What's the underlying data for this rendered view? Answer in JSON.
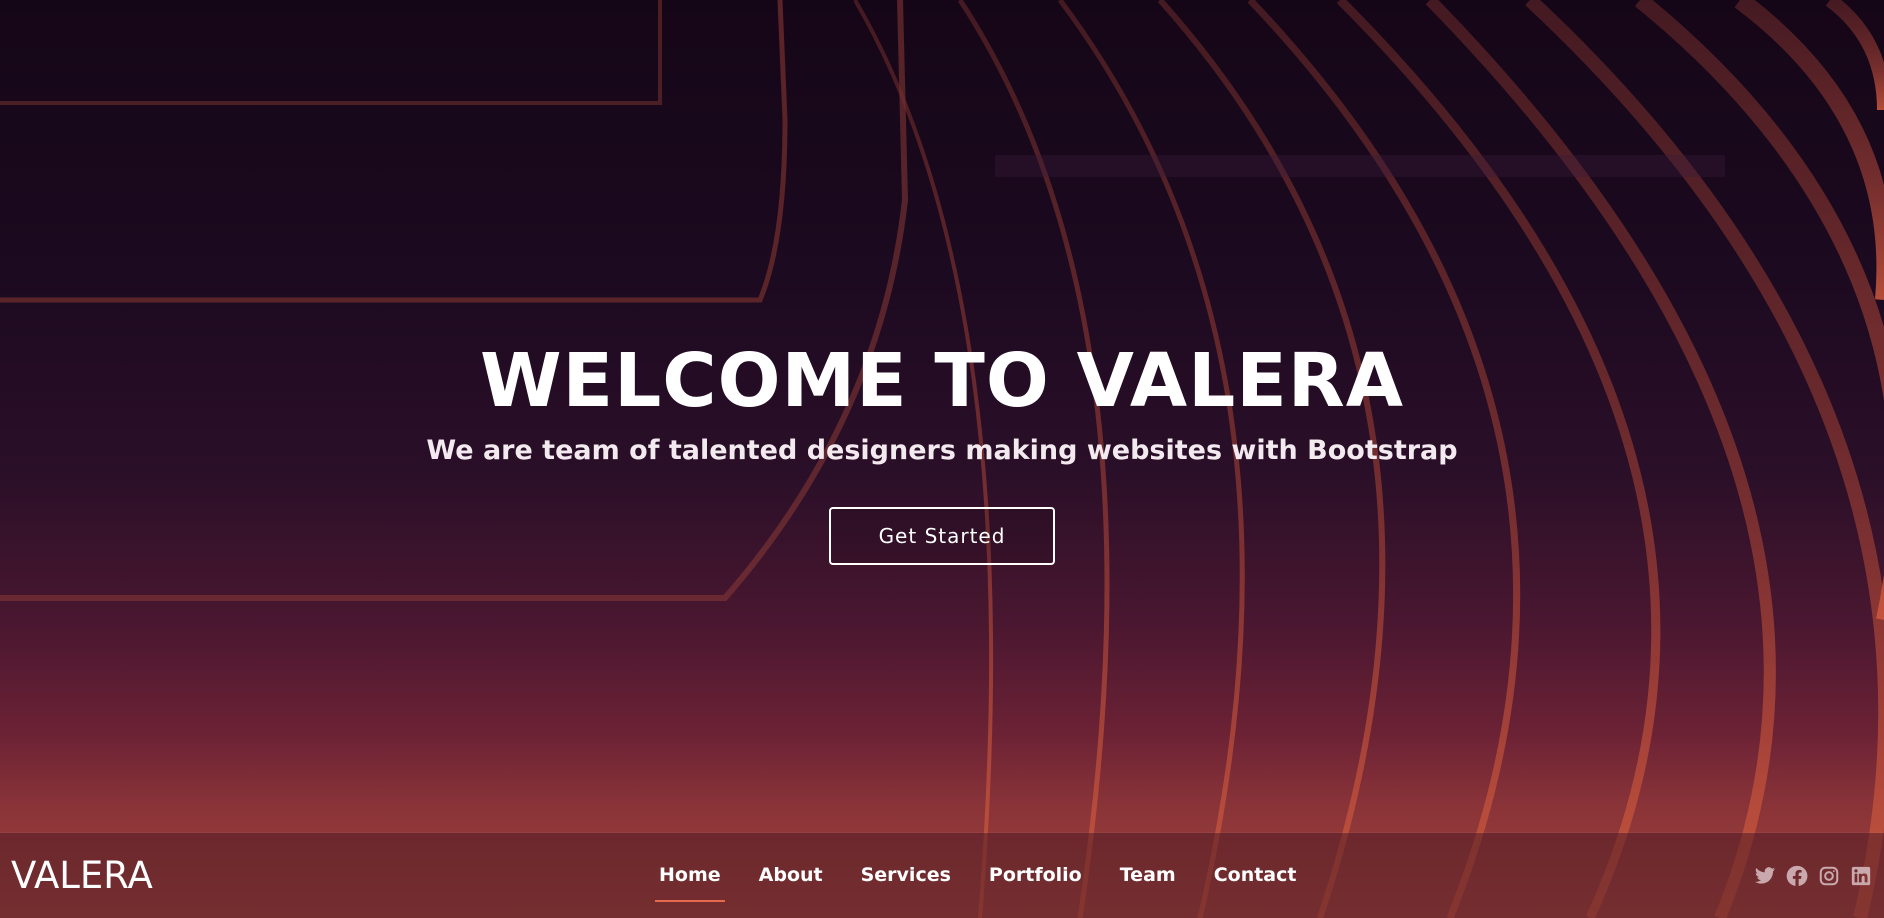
{
  "hero": {
    "title": "WELCOME TO VALERA",
    "subtitle": "We are team of talented designers making websites with Bootstrap",
    "cta_label": "Get Started"
  },
  "navbar": {
    "logo": "VALERA",
    "items": [
      {
        "label": "Home",
        "active": true
      },
      {
        "label": "About"
      },
      {
        "label": "Services"
      },
      {
        "label": "Portfolio"
      },
      {
        "label": "Team"
      },
      {
        "label": "Contact"
      }
    ],
    "social": [
      "twitter-icon",
      "facebook-icon",
      "instagram-icon",
      "linkedin-icon"
    ]
  },
  "colors": {
    "accent": "#e86a4e",
    "background_top": "#150617",
    "background_bottom": "#a5463e",
    "text": "#ffffff"
  }
}
